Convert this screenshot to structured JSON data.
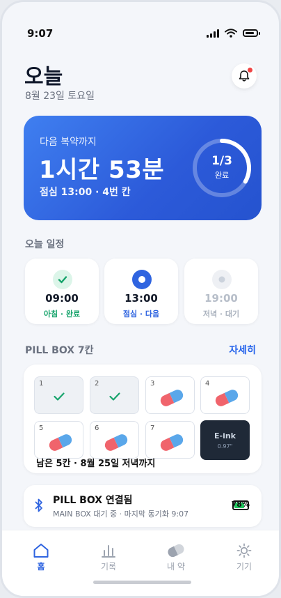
{
  "status": {
    "time": "9:07"
  },
  "header": {
    "title": "오늘",
    "date": "8월 23일 토요일"
  },
  "next_dose": {
    "label": "다음 복약까지",
    "countdown": "1시간 53분",
    "detail": "점심 13:00 · 4번 칸",
    "progress_text": "1/3",
    "progress_label": "완료",
    "progress_fraction": 0.333
  },
  "schedule": {
    "title": "오늘 일정",
    "items": [
      {
        "time": "09:00",
        "status": "아침 · 완료",
        "state": "done"
      },
      {
        "time": "13:00",
        "status": "점심 · 다음",
        "state": "next"
      },
      {
        "time": "19:00",
        "status": "저녁 · 대기",
        "state": "waiting"
      }
    ]
  },
  "pillbox": {
    "title": "PILL BOX 7칸",
    "more": "자세히",
    "cells": [
      {
        "num": "1",
        "state": "done"
      },
      {
        "num": "2",
        "state": "done"
      },
      {
        "num": "3",
        "state": "filled"
      },
      {
        "num": "4",
        "state": "filled"
      },
      {
        "num": "5",
        "state": "filled"
      },
      {
        "num": "6",
        "state": "filled"
      },
      {
        "num": "7",
        "state": "filled"
      }
    ],
    "eink_label": "E-ink",
    "eink_size": "0.97\"",
    "remaining": "남은 5칸 · 8월 25일 저녁까지"
  },
  "connection": {
    "title": "PILL BOX 연결됨",
    "subtitle": "MAIN BOX 대기 중 · 마지막 동기화 9:07",
    "battery_pct": "78%",
    "battery_fraction": 0.78
  },
  "tabs": [
    {
      "label": "홈",
      "icon": "home-icon",
      "active": true
    },
    {
      "label": "기록",
      "icon": "chart-icon",
      "active": false
    },
    {
      "label": "내 약",
      "icon": "pill-icon",
      "active": false
    },
    {
      "label": "기기",
      "icon": "sun-icon",
      "active": false
    }
  ],
  "colors": {
    "accent": "#2f64e0",
    "done": "#16a36b",
    "pill_red": "#f0646c",
    "pill_blue": "#5aa7ea"
  }
}
